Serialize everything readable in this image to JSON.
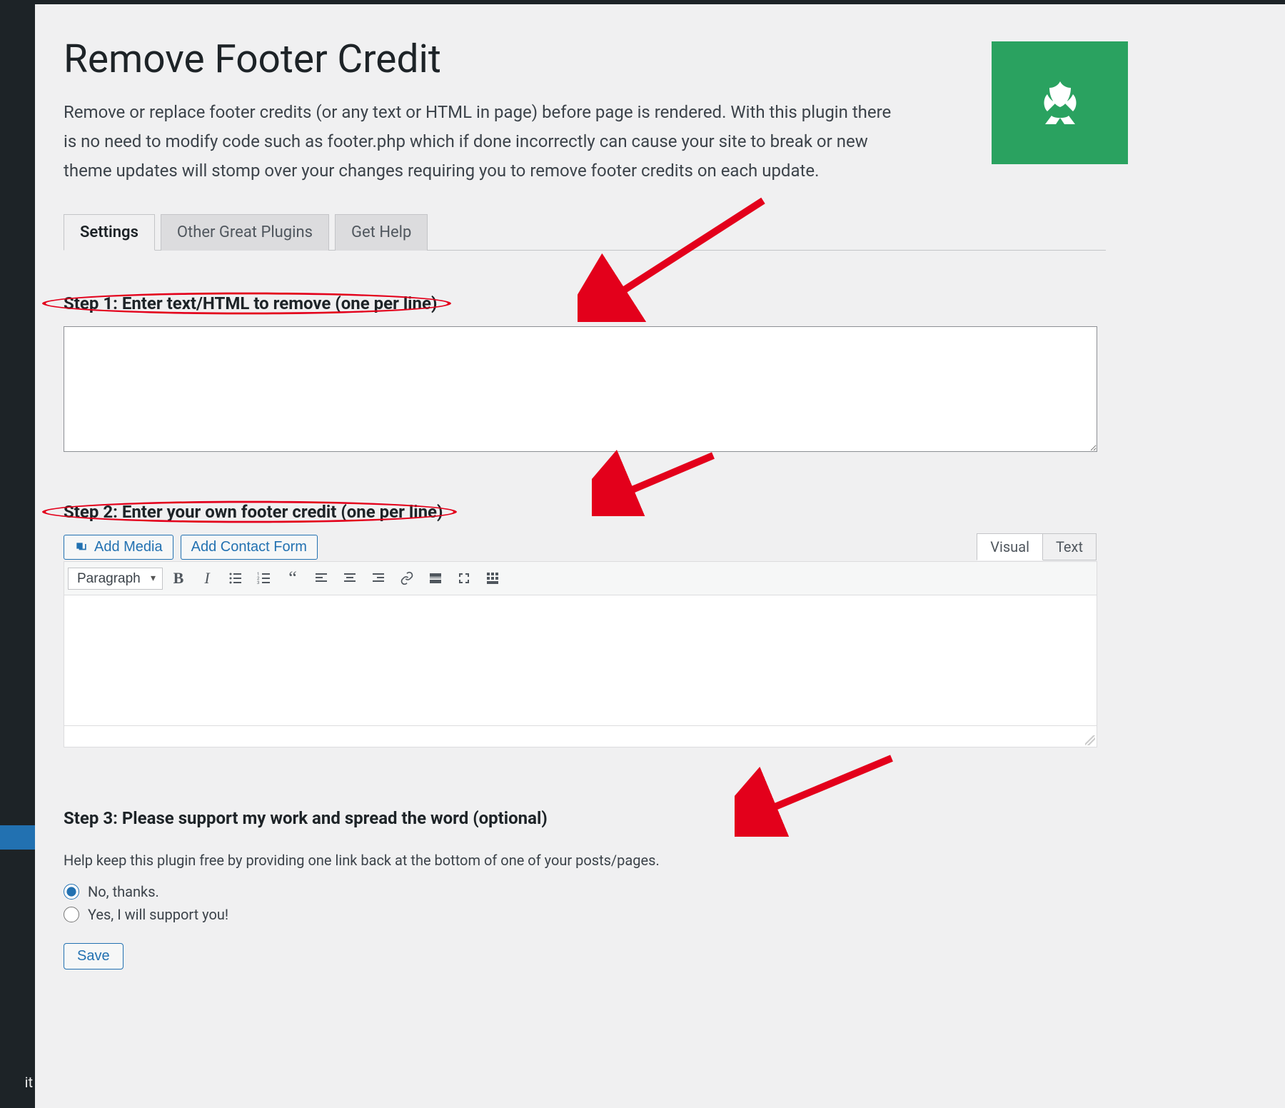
{
  "sidebar": {
    "current_label_short": "it"
  },
  "header": {
    "title": "Remove Footer Credit",
    "description": "Remove or replace footer credits (or any text or HTML in page) before page is rendered. With this plugin there is no need to modify code such as footer.php which if done incorrectly can cause your site to break or new theme updates will stomp over your changes requiring you to remove footer credits on each update."
  },
  "tabs": [
    {
      "label": "Settings",
      "active": true
    },
    {
      "label": "Other Great Plugins",
      "active": false
    },
    {
      "label": "Get Help",
      "active": false
    }
  ],
  "step1": {
    "heading": "Step 1: Enter text/HTML to remove (one per line)",
    "value": ""
  },
  "step2": {
    "heading": "Step 2: Enter your own footer credit (one per line)",
    "add_media": "Add Media",
    "add_contact_form": "Add Contact Form",
    "editor_tabs": {
      "visual": "Visual",
      "text": "Text"
    },
    "format_select": "Paragraph"
  },
  "step3": {
    "heading": "Step 3: Please support my work and spread the word (optional)",
    "sub": "Help keep this plugin free by providing one link back at the bottom of one of your posts/pages.",
    "option_no": "No, thanks.",
    "option_yes": "Yes, I will support you!",
    "selected": "no"
  },
  "save_label": "Save",
  "colors": {
    "accent": "#2271b1",
    "annotation": "#e3001b",
    "logo_bg": "#2aa260"
  }
}
